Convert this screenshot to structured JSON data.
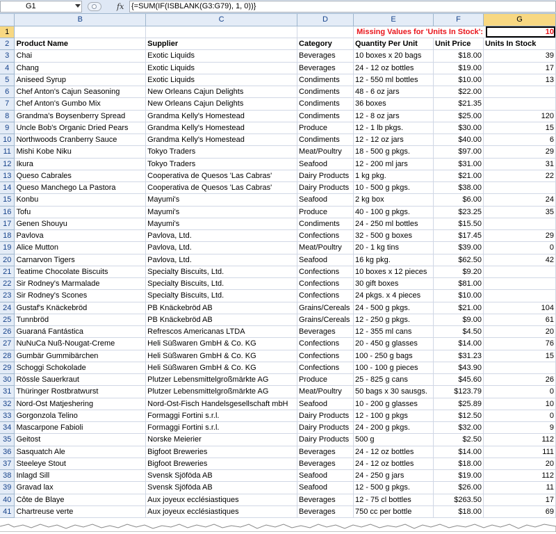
{
  "name_box": "G1",
  "formula": "{=SUM(IF(ISBLANK(G3:G79), 1, 0))}",
  "fx_label": "fx",
  "columns": [
    "B",
    "C",
    "D",
    "E",
    "F",
    "G"
  ],
  "row1": {
    "label": "Missing Values for 'Units In Stock':",
    "value": "10"
  },
  "headers": [
    "Product Name",
    "Supplier",
    "Category",
    "Quantity Per Unit",
    "Unit Price",
    "Units In Stock"
  ],
  "rows": [
    [
      "3",
      "Chai",
      "Exotic Liquids",
      "Beverages",
      "10 boxes x 20 bags",
      "$18.00",
      "39"
    ],
    [
      "4",
      "Chang",
      "Exotic Liquids",
      "Beverages",
      "24 - 12 oz bottles",
      "$19.00",
      "17"
    ],
    [
      "5",
      "Aniseed Syrup",
      "Exotic Liquids",
      "Condiments",
      "12 - 550 ml bottles",
      "$10.00",
      "13"
    ],
    [
      "6",
      "Chef Anton's Cajun Seasoning",
      "New Orleans Cajun Delights",
      "Condiments",
      "48 - 6 oz jars",
      "$22.00",
      ""
    ],
    [
      "7",
      "Chef Anton's Gumbo Mix",
      "New Orleans Cajun Delights",
      "Condiments",
      "36 boxes",
      "$21.35",
      ""
    ],
    [
      "8",
      "Grandma's Boysenberry Spread",
      "Grandma Kelly's Homestead",
      "Condiments",
      "12 - 8 oz jars",
      "$25.00",
      "120"
    ],
    [
      "9",
      "Uncle Bob's Organic Dried Pears",
      "Grandma Kelly's Homestead",
      "Produce",
      "12 - 1 lb pkgs.",
      "$30.00",
      "15"
    ],
    [
      "10",
      "Northwoods Cranberry Sauce",
      "Grandma Kelly's Homestead",
      "Condiments",
      "12 - 12 oz jars",
      "$40.00",
      "6"
    ],
    [
      "11",
      "Mishi Kobe Niku",
      "Tokyo Traders",
      "Meat/Poultry",
      "18 - 500 g pkgs.",
      "$97.00",
      "29"
    ],
    [
      "12",
      "Ikura",
      "Tokyo Traders",
      "Seafood",
      "12 - 200 ml jars",
      "$31.00",
      "31"
    ],
    [
      "13",
      "Queso Cabrales",
      "Cooperativa de Quesos 'Las Cabras'",
      "Dairy Products",
      "1 kg pkg.",
      "$21.00",
      "22"
    ],
    [
      "14",
      "Queso Manchego La Pastora",
      "Cooperativa de Quesos 'Las Cabras'",
      "Dairy Products",
      "10 - 500 g pkgs.",
      "$38.00",
      ""
    ],
    [
      "15",
      "Konbu",
      "Mayumi's",
      "Seafood",
      "2 kg box",
      "$6.00",
      "24"
    ],
    [
      "16",
      "Tofu",
      "Mayumi's",
      "Produce",
      "40 - 100 g pkgs.",
      "$23.25",
      "35"
    ],
    [
      "17",
      "Genen Shouyu",
      "Mayumi's",
      "Condiments",
      "24 - 250 ml bottles",
      "$15.50",
      ""
    ],
    [
      "18",
      "Pavlova",
      "Pavlova, Ltd.",
      "Confections",
      "32 - 500 g boxes",
      "$17.45",
      "29"
    ],
    [
      "19",
      "Alice Mutton",
      "Pavlova, Ltd.",
      "Meat/Poultry",
      "20 - 1 kg tins",
      "$39.00",
      "0"
    ],
    [
      "20",
      "Carnarvon Tigers",
      "Pavlova, Ltd.",
      "Seafood",
      "16 kg pkg.",
      "$62.50",
      "42"
    ],
    [
      "21",
      "Teatime Chocolate Biscuits",
      "Specialty Biscuits, Ltd.",
      "Confections",
      "10 boxes x 12 pieces",
      "$9.20",
      ""
    ],
    [
      "22",
      "Sir Rodney's Marmalade",
      "Specialty Biscuits, Ltd.",
      "Confections",
      "30 gift boxes",
      "$81.00",
      ""
    ],
    [
      "23",
      "Sir Rodney's Scones",
      "Specialty Biscuits, Ltd.",
      "Confections",
      "24 pkgs. x 4 pieces",
      "$10.00",
      ""
    ],
    [
      "24",
      "Gustaf's Knäckebröd",
      "PB Knäckebröd AB",
      "Grains/Cereals",
      "24 - 500 g pkgs.",
      "$21.00",
      "104"
    ],
    [
      "25",
      "Tunnbröd",
      "PB Knäckebröd AB",
      "Grains/Cereals",
      "12 - 250 g pkgs.",
      "$9.00",
      "61"
    ],
    [
      "26",
      "Guaraná Fantástica",
      "Refrescos Americanas LTDA",
      "Beverages",
      "12 - 355 ml cans",
      "$4.50",
      "20"
    ],
    [
      "27",
      "NuNuCa Nuß-Nougat-Creme",
      "Heli Süßwaren GmbH & Co. KG",
      "Confections",
      "20 - 450 g glasses",
      "$14.00",
      "76"
    ],
    [
      "28",
      "Gumbär Gummibärchen",
      "Heli Süßwaren GmbH & Co. KG",
      "Confections",
      "100 - 250 g bags",
      "$31.23",
      "15"
    ],
    [
      "29",
      "Schoggi Schokolade",
      "Heli Süßwaren GmbH & Co. KG",
      "Confections",
      "100 - 100 g pieces",
      "$43.90",
      ""
    ],
    [
      "30",
      "Rössle Sauerkraut",
      "Plutzer Lebensmittelgroßmärkte AG",
      "Produce",
      "25 - 825 g cans",
      "$45.60",
      "26"
    ],
    [
      "31",
      "Thüringer Rostbratwurst",
      "Plutzer Lebensmittelgroßmärkte AG",
      "Meat/Poultry",
      "50 bags x 30 sausgs.",
      "$123.79",
      "0"
    ],
    [
      "32",
      "Nord-Ost Matjeshering",
      "Nord-Ost-Fisch Handelsgesellschaft mbH",
      "Seafood",
      "10 - 200 g glasses",
      "$25.89",
      "10"
    ],
    [
      "33",
      "Gorgonzola Telino",
      "Formaggi Fortini s.r.l.",
      "Dairy Products",
      "12 - 100 g pkgs",
      "$12.50",
      "0"
    ],
    [
      "34",
      "Mascarpone Fabioli",
      "Formaggi Fortini s.r.l.",
      "Dairy Products",
      "24 - 200 g pkgs.",
      "$32.00",
      "9"
    ],
    [
      "35",
      "Geitost",
      "Norske Meierier",
      "Dairy Products",
      "500 g",
      "$2.50",
      "112"
    ],
    [
      "36",
      "Sasquatch Ale",
      "Bigfoot Breweries",
      "Beverages",
      "24 - 12 oz bottles",
      "$14.00",
      "111"
    ],
    [
      "37",
      "Steeleye Stout",
      "Bigfoot Breweries",
      "Beverages",
      "24 - 12 oz bottles",
      "$18.00",
      "20"
    ],
    [
      "38",
      "Inlagd Sill",
      "Svensk Sjöföda AB",
      "Seafood",
      "24 - 250 g  jars",
      "$19.00",
      "112"
    ],
    [
      "39",
      "Gravad lax",
      "Svensk Sjöföda AB",
      "Seafood",
      "12 - 500 g pkgs.",
      "$26.00",
      "11"
    ],
    [
      "40",
      "Côte de Blaye",
      "Aux joyeux ecclésiastiques",
      "Beverages",
      "12 - 75 cl bottles",
      "$263.50",
      "17"
    ],
    [
      "41",
      "Chartreuse verte",
      "Aux joyeux ecclésiastiques",
      "Beverages",
      "750 cc per bottle",
      "$18.00",
      "69"
    ]
  ]
}
